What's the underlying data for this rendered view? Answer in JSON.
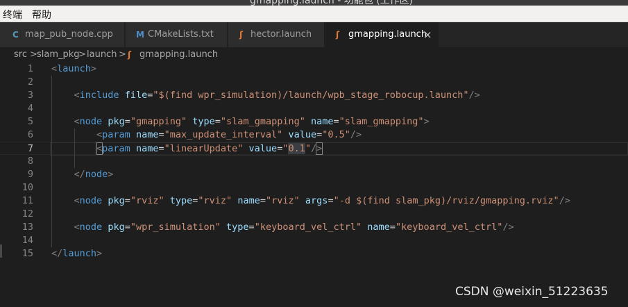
{
  "window": {
    "title": "gmapping.launch - 功能包 (工作区)"
  },
  "menu": [
    "终端",
    "帮助"
  ],
  "tabs": [
    {
      "icon": "C",
      "icon_name": "cpp-file-icon",
      "label": "map_pub_node.cpp",
      "active": false
    },
    {
      "icon": "M",
      "icon_name": "cmake-file-icon",
      "label": "CMakeLists.txt",
      "active": false
    },
    {
      "icon": "ʃ",
      "icon_name": "rss-launch-icon",
      "label": "hector.launch",
      "active": false
    },
    {
      "icon": "ʃ",
      "icon_name": "rss-launch-icon",
      "label": "gmapping.launch",
      "active": true,
      "close": "×"
    }
  ],
  "breadcrumb": {
    "items": [
      "src",
      "slam_pkg",
      "launch",
      "gmapping.launch"
    ],
    "separator": ">"
  },
  "editor": {
    "current_line": 7,
    "lines": [
      {
        "n": "1",
        "text": "<launch>"
      },
      {
        "n": "2",
        "text": ""
      },
      {
        "n": "3",
        "text": "    <include file=\"$(find wpr_simulation)/launch/wpb_stage_robocup.launch\"/>"
      },
      {
        "n": "4",
        "text": ""
      },
      {
        "n": "5",
        "text": "    <node pkg=\"gmapping\" type=\"slam_gmapping\" name=\"slam_gmapping\">"
      },
      {
        "n": "6",
        "text": "        <param name=\"max_update_interval\" value=\"0.5\"/>"
      },
      {
        "n": "7",
        "text": "        <param name=\"linearUpdate\" value=\"0.1\"/>"
      },
      {
        "n": "8",
        "text": ""
      },
      {
        "n": "9",
        "text": "    </node>"
      },
      {
        "n": "10",
        "text": ""
      },
      {
        "n": "11",
        "text": "    <node pkg=\"rviz\" type=\"rviz\" name=\"rviz\" args=\"-d $(find slam_pkg)/rviz/gmapping.rviz\"/>"
      },
      {
        "n": "12",
        "text": ""
      },
      {
        "n": "13",
        "text": "    <node pkg=\"wpr_simulation\" type=\"keyboard_vel_ctrl\" name=\"keyboard_vel_ctrl\"/>"
      },
      {
        "n": "14",
        "text": ""
      },
      {
        "n": "15",
        "text": "</launch>"
      }
    ]
  },
  "watermark": "CSDN @weixin_51223635",
  "colors": {
    "background": "#1e1e1e",
    "tag_bracket": "#808080",
    "tag_name": "#569cd6",
    "attr_name": "#9cdcfe",
    "attr_value": "#ce9178",
    "launch_icon": "#e37933",
    "cpp_icon": "#519aba",
    "cmake_icon": "#4d8fc8"
  }
}
